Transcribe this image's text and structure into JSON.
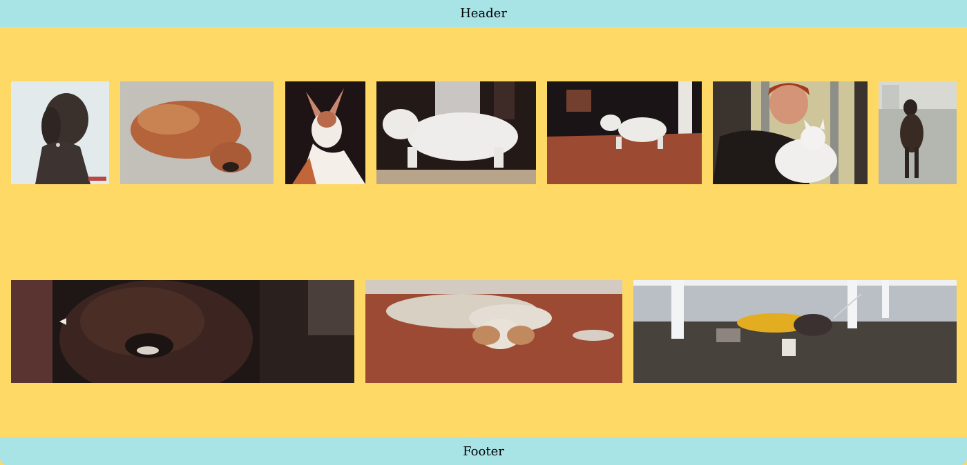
{
  "header": {
    "label": "Header"
  },
  "footer": {
    "label": "Footer"
  },
  "gallery": {
    "rows": [
      {
        "photos": [
          {
            "name": "poodle-photo"
          },
          {
            "name": "pekingese-photo"
          },
          {
            "name": "ibizan-hound-photo"
          },
          {
            "name": "sealyham-terrier-show-photo"
          },
          {
            "name": "white-terrier-show-photo"
          },
          {
            "name": "woman-with-westie-photo"
          },
          {
            "name": "doberman-photo"
          }
        ]
      },
      {
        "photos": [
          {
            "name": "shaggy-dog-closeup-photo"
          },
          {
            "name": "lying-hound-photo"
          },
          {
            "name": "dogs-on-leash-photo"
          }
        ]
      }
    ]
  }
}
